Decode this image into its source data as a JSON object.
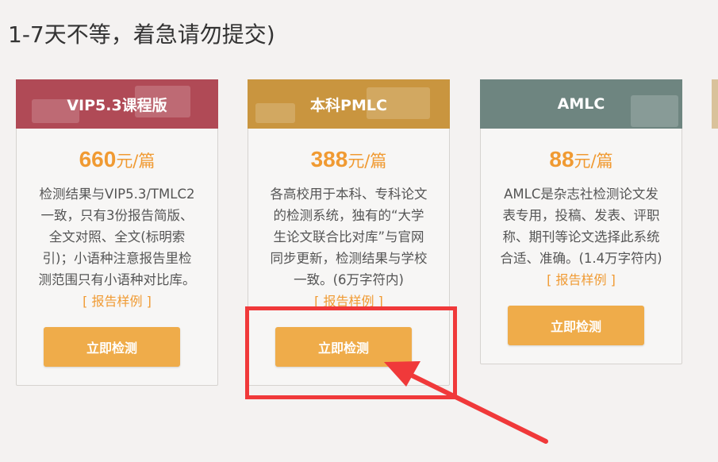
{
  "headline": "1-7天不等，着急请勿提交)",
  "cards": [
    {
      "title": "VIP5.3课程版",
      "price": "660",
      "unit": "元/篇",
      "desc_lines": [
        "检测结果与VIP5.3/TMLC2",
        "一致，只有3份报告简版、",
        "全文对照、全文(标明索",
        "引)；小语种注意报告里检",
        "测范围只有小语种对比库。"
      ],
      "sample": "[ 报告样例 ]",
      "button": "立即检测",
      "color": "#b04a56"
    },
    {
      "title": "本科PMLC",
      "price": "388",
      "unit": "元/篇",
      "desc_lines": [
        "各高校用于本科、专科论文",
        "的检测系统，独有的“大学",
        "生论文联合比对库”与官网",
        "同步更新，检测结果与学校",
        "一致。(6万字符内)"
      ],
      "sample": "[ 报告样例 ]",
      "button": "立即检测",
      "color": "#c9953f"
    },
    {
      "title": "AMLC",
      "price": "88",
      "unit": "元/篇",
      "desc_lines": [
        "AMLC是杂志社检测论文发",
        "表专用，投稿、发表、评职",
        "称、期刊等论文选择此系统",
        "合适、准确。(1.4万字符内)"
      ],
      "sample": "[ 报告样例 ]",
      "button": "立即检测",
      "color": "#6e8580"
    }
  ],
  "annotation": {
    "highlight_color": "#f0393a"
  }
}
